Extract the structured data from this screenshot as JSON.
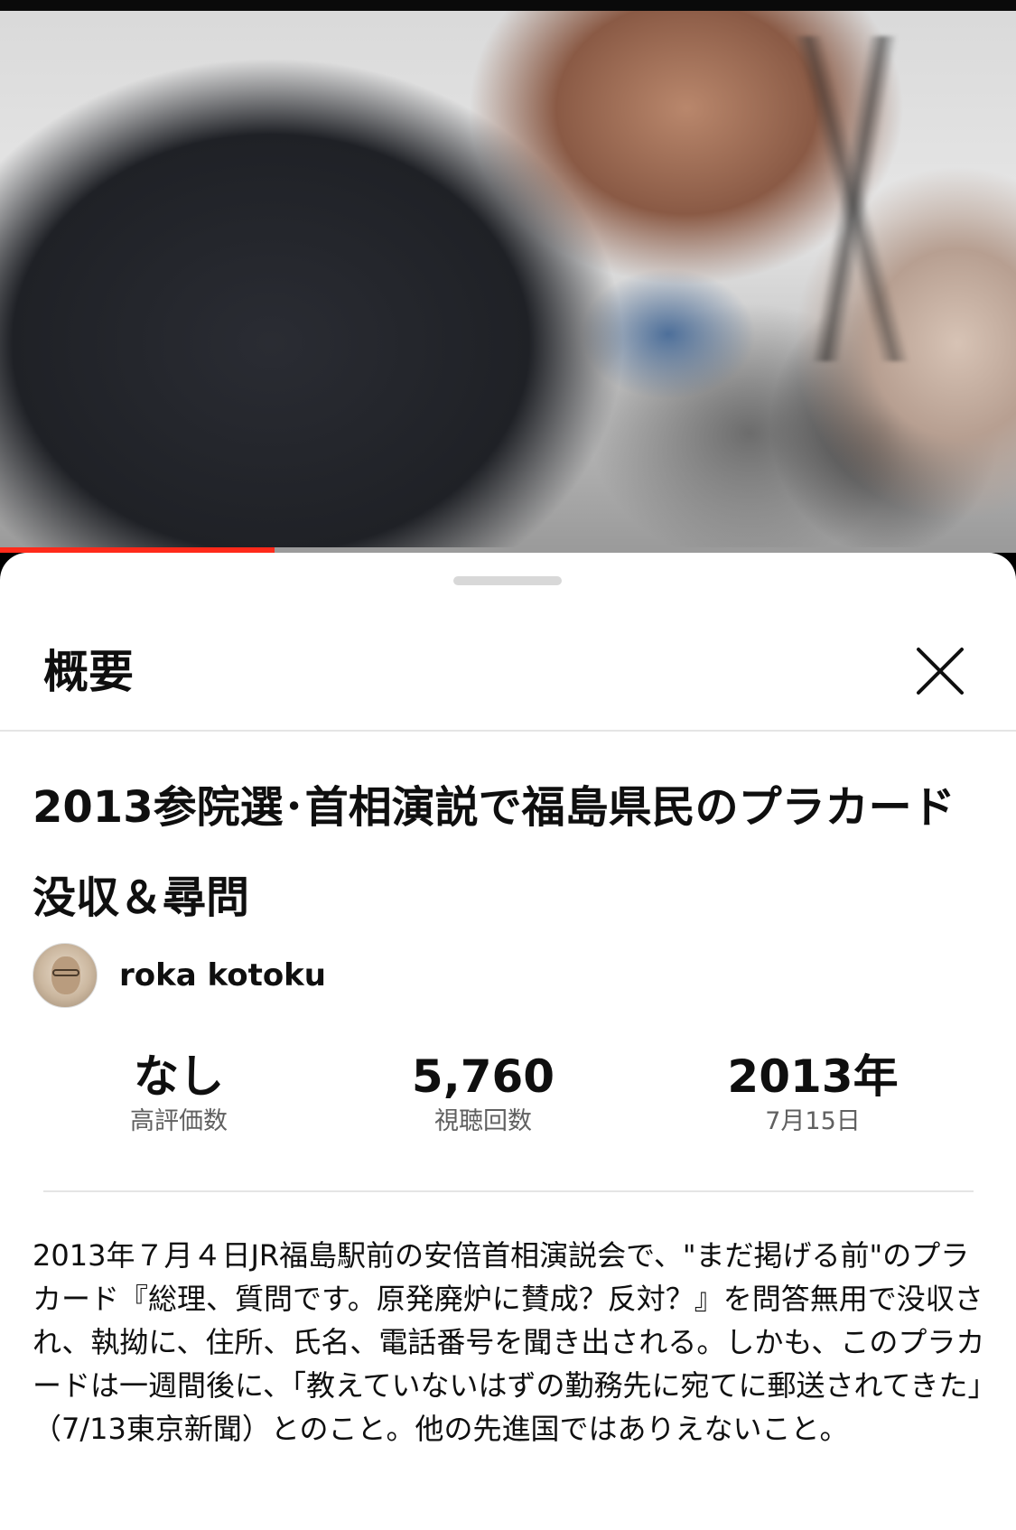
{
  "video": {
    "progress_fraction": 0.27
  },
  "sheet": {
    "title": "概要",
    "close_icon": "close-icon"
  },
  "video_info": {
    "title": "2013参院選･首相演説で福島県民のプラカード没収＆尋問",
    "channel_name": "roka kotoku"
  },
  "stats": {
    "likes_value": "なし",
    "likes_label": "高評価数",
    "views_value": "5,760",
    "views_label": "視聴回数",
    "year_value": "2013年",
    "date_label": "7月15日"
  },
  "description": "2013年７月４日JR福島駅前の安倍首相演説会で、\"まだ掲げる前\"のプラカード『総理、質問です。原発廃炉に賛成？反対？』を問答無用で没収され、執拗に、住所、氏名、電話番号を聞き出される。しかも、このプラカードは一週間後に、「教えていないはずの勤務先に宛てに郵送されてきた」（7/13東京新聞）とのこと。他の先進国ではありえないこと。",
  "colors": {
    "progress": "#ff2a1a",
    "sheet_background": "#ffffff",
    "text_primary": "#0f0f0f",
    "text_secondary": "#606060"
  }
}
